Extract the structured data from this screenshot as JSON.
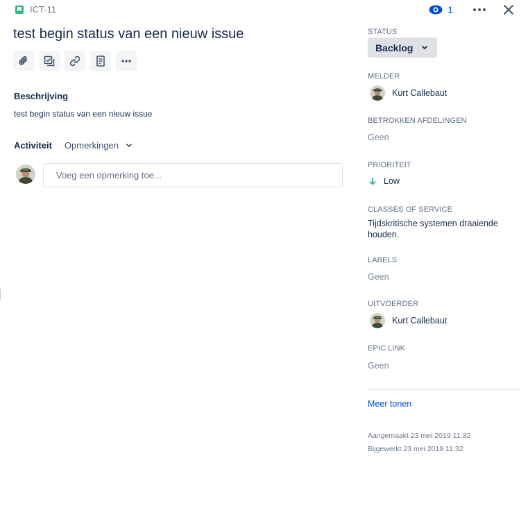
{
  "issue": {
    "key": "ICT-11",
    "title": "test begin status van een nieuw issue",
    "watchers": "1"
  },
  "toolbar": {
    "attach_icon": "paperclip-icon",
    "subtask_icon": "subtask-icon",
    "link_icon": "link-icon",
    "page_icon": "document-icon",
    "more_icon": "more-icon"
  },
  "description": {
    "label": "Beschrijving",
    "text": "test begin status van een nieuw issue"
  },
  "activity": {
    "label": "Activiteit",
    "filter": "Opmerkingen",
    "comment_placeholder": "Voeg een opmerking toe..."
  },
  "sidebar": {
    "status": {
      "label": "STATUS",
      "value": "Backlog"
    },
    "reporter": {
      "label": "MELDER",
      "value": "Kurt Callebaut"
    },
    "departments": {
      "label": "BETROKKEN AFDELINGEN",
      "value": "Geen"
    },
    "priority": {
      "label": "PRIORITEIT",
      "value": "Low",
      "color": "#36b37e"
    },
    "class_of_service": {
      "label": "CLASSES OF SERVICE",
      "value": "Tijdskritische systemen draaiende houden."
    },
    "labels": {
      "label": "LABELS",
      "value": "Geen"
    },
    "assignee": {
      "label": "UITVOERDER",
      "value": "Kurt Callebaut"
    },
    "epic_link": {
      "label": "EPIC LINK",
      "value": "Geen"
    },
    "more_link": "Meer tonen",
    "created": "Aangemaakt 23 mei 2019 11:32",
    "updated": "Bijgewerkt 23 mei 2019 11:32"
  },
  "colors": {
    "accent": "#0052cc",
    "text": "#172b4d",
    "muted": "#6b778c",
    "story": "#36b37e"
  }
}
